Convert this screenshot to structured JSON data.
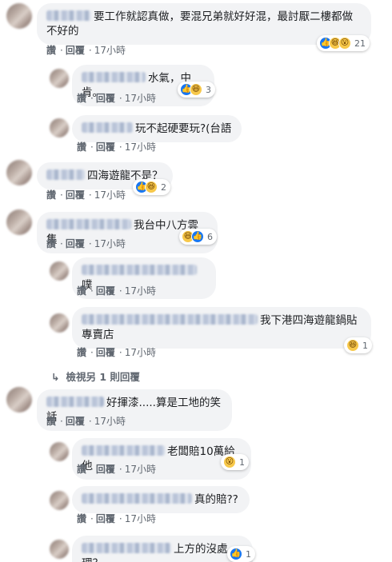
{
  "actions": {
    "read": "讚",
    "reply": "回覆",
    "dot": "·"
  },
  "comments": [
    {
      "text": "要工作就認真做，要混兄弟就好好混，最討厭二樓都做不好的",
      "time": "17小時",
      "reaction_count": "21",
      "reaction_icons": [
        "like-icon",
        "haha-icon",
        "wow-icon"
      ]
    },
    {
      "text": "水氣，中肯。",
      "time": "17小時",
      "reaction_count": "3",
      "reaction_icons": [
        "like-icon",
        "haha-icon"
      ]
    },
    {
      "text": "玩不起硬要玩?(台語",
      "time": "17小時"
    },
    {
      "text": "四海遊龍不是？",
      "time": "17小時",
      "reaction_count": "2",
      "reaction_icons": [
        "like-icon",
        "haha-icon"
      ]
    },
    {
      "text": "我台中八方雲集",
      "time": "17小時",
      "reaction_count": "6",
      "reaction_icons": [
        "haha-icon",
        "like-icon"
      ]
    },
    {
      "text": "噗",
      "time": "17小時"
    },
    {
      "text": "我下港四海遊龍鍋貼專賣店",
      "time": "17小時",
      "reaction_count": "1",
      "reaction_icons": [
        "haha-icon"
      ]
    },
    {
      "text": "好揮漆.....算是工地的笑話",
      "time": "17小時"
    },
    {
      "text": "老闆賠10萬給他",
      "time": "17小時",
      "reaction_count": "1",
      "reaction_icons": [
        "wow-icon"
      ]
    },
    {
      "text": "真的賠??",
      "time": "17小時"
    },
    {
      "text": "上方的沒處理？",
      "time": "",
      "reaction_count": "1",
      "reaction_icons": [
        "like-icon"
      ]
    }
  ],
  "more_replies": "檢視另 1 則回覆",
  "icons": {
    "reply_arrow": "reply-arrow-icon"
  },
  "colors": {
    "bubble": "#f2f3f5",
    "like": "#1877f2",
    "haha": "#f7c84a",
    "meta": "#606770"
  }
}
